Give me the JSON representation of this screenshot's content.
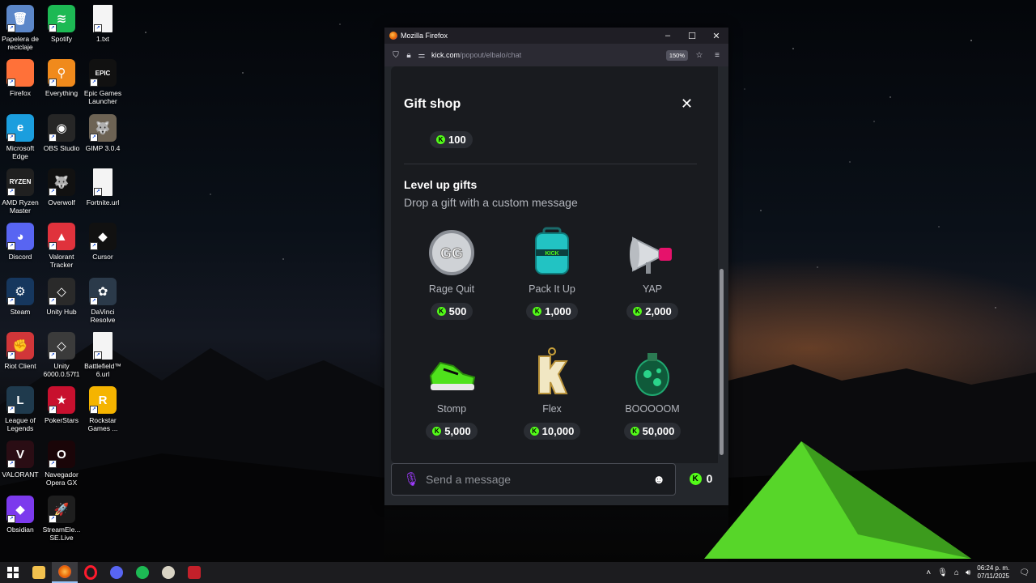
{
  "desktop": {
    "icons": [
      {
        "label": "Papelera de reciclaje",
        "name": "recycle-bin-icon",
        "color": "#5c87c9",
        "glyph": "🗑"
      },
      {
        "label": "Spotify",
        "name": "spotify-icon",
        "color": "#1db954",
        "glyph": "≋"
      },
      {
        "label": "1.txt",
        "name": "text-file-icon",
        "color": "#f4f4f4",
        "glyph": ""
      },
      {
        "label": "Firefox",
        "name": "firefox-icon",
        "color": "#ff7139",
        "glyph": ""
      },
      {
        "label": "Everything",
        "name": "everything-search-icon",
        "color": "#f08a1c",
        "glyph": "⚲"
      },
      {
        "label": "Epic Games Launcher",
        "name": "epic-games-icon",
        "color": "#111111",
        "glyph": "EPIC"
      },
      {
        "label": "Microsoft Edge",
        "name": "edge-icon",
        "color": "#1b9ede",
        "glyph": "e"
      },
      {
        "label": "OBS Studio",
        "name": "obs-studio-icon",
        "color": "#262626",
        "glyph": "◉"
      },
      {
        "label": "GIMP 3.0.4",
        "name": "gimp-icon",
        "color": "#6d6354",
        "glyph": "🐺"
      },
      {
        "label": "AMD Ryzen Master",
        "name": "ryzen-master-icon",
        "color": "#202020",
        "glyph": "RYZEN"
      },
      {
        "label": "Overwolf",
        "name": "overwolf-icon",
        "color": "#111111",
        "glyph": "🐺"
      },
      {
        "label": "Fortnite.url",
        "name": "url-file-icon",
        "color": "#f4f4f4",
        "glyph": ""
      },
      {
        "label": "Discord",
        "name": "discord-icon",
        "color": "#5865f2",
        "glyph": "◕"
      },
      {
        "label": "Valorant Tracker",
        "name": "valorant-tracker-icon",
        "color": "#e0323c",
        "glyph": "▲"
      },
      {
        "label": "Cursor",
        "name": "cursor-app-icon",
        "color": "#111111",
        "glyph": "◆"
      },
      {
        "label": "Steam",
        "name": "steam-icon",
        "color": "#16375e",
        "glyph": "⚙"
      },
      {
        "label": "Unity Hub",
        "name": "unity-hub-icon",
        "color": "#2a2a2a",
        "glyph": "◇"
      },
      {
        "label": "DaVinci Resolve",
        "name": "davinci-resolve-icon",
        "color": "#2b3a4a",
        "glyph": "✿"
      },
      {
        "label": "Riot Client",
        "name": "riot-client-icon",
        "color": "#d13639",
        "glyph": "✊"
      },
      {
        "label": "Unity 6000.0.57f1",
        "name": "unity-editor-icon",
        "color": "#3b3b3b",
        "glyph": "◇"
      },
      {
        "label": "Battlefield™ 6.url",
        "name": "url-file-icon",
        "color": "#f4f4f4",
        "glyph": ""
      },
      {
        "label": "League of Legends",
        "name": "league-of-legends-icon",
        "color": "#1f3a4d",
        "glyph": "L"
      },
      {
        "label": "PokerStars",
        "name": "pokerstars-icon",
        "color": "#c8102e",
        "glyph": "★"
      },
      {
        "label": "Rockstar Games ...",
        "name": "rockstar-games-icon",
        "color": "#f5b400",
        "glyph": "R"
      },
      {
        "label": "VALORANT",
        "name": "valorant-icon",
        "color": "#2a0d14",
        "glyph": "V"
      },
      {
        "label": "Navegador Opera GX",
        "name": "opera-gx-icon",
        "color": "#1a0508",
        "glyph": "O"
      },
      {
        "label": "",
        "name": "empty-slot",
        "color": "transparent",
        "glyph": ""
      },
      {
        "label": "Obsidian",
        "name": "obsidian-icon",
        "color": "#7c3aed",
        "glyph": "◆"
      },
      {
        "label": "StreamEle... SE.Live",
        "name": "streamelements-icon",
        "color": "#1e1e1e",
        "glyph": "🚀"
      }
    ]
  },
  "window": {
    "title": "Mozilla Firefox",
    "url_host": "kick.com",
    "url_path": "/popout/elbalo/chat",
    "zoom": "150%"
  },
  "gift_shop": {
    "title": "Gift shop",
    "top_price": "100",
    "section_title": "Level up gifts",
    "section_subtitle": "Drop a gift with a custom message",
    "gifts": [
      {
        "name": "Rage Quit",
        "price": "500"
      },
      {
        "name": "Pack It Up",
        "price": "1,000"
      },
      {
        "name": "YAP",
        "price": "2,000"
      },
      {
        "name": "Stomp",
        "price": "5,000"
      },
      {
        "name": "Flex",
        "price": "10,000"
      },
      {
        "name": "BOOOOOM",
        "price": "50,000"
      }
    ]
  },
  "chat": {
    "placeholder": "Send a message",
    "balance": "0"
  },
  "taskbar": {
    "time": "06:24 p. m.",
    "date": "07/11/2025"
  },
  "colors": {
    "kick_green": "#53fc18",
    "mic_purple": "#9f3bff"
  }
}
